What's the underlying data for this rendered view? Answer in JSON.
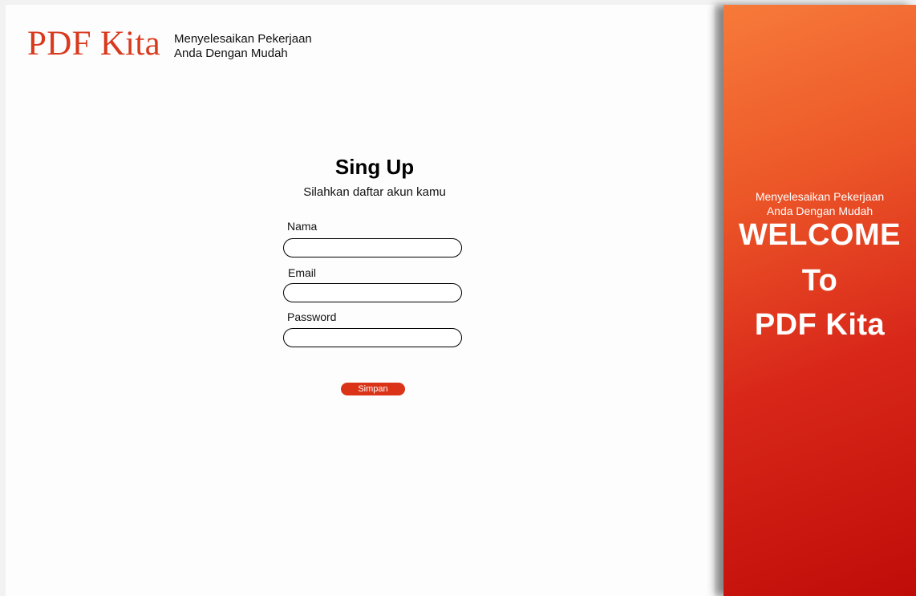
{
  "header": {
    "logo_text": "PDF Kita",
    "tagline_line1": "Menyelesaikan Pekerjaan",
    "tagline_line2": "Anda Dengan Mudah"
  },
  "form": {
    "title": "Sing Up",
    "subtitle": "Silahkan daftar akun kamu",
    "fields": [
      {
        "label": "Nama",
        "value": "",
        "placeholder": ""
      },
      {
        "label": "Email",
        "value": "",
        "placeholder": ""
      },
      {
        "label": "Password",
        "value": "",
        "placeholder": ""
      }
    ],
    "submit_label": "Simpan"
  },
  "side_panel": {
    "tagline_line1": "Menyelesaikan Pekerjaan",
    "tagline_line2": "Anda Dengan Mudah",
    "welcome_line1": "WELCOME",
    "welcome_line2": "To",
    "welcome_line3": "PDF Kita"
  },
  "colors": {
    "brand": "#d93a1e",
    "button": "#da3317",
    "gradient_top": "#f77a3a",
    "gradient_bottom": "#c00c08"
  }
}
